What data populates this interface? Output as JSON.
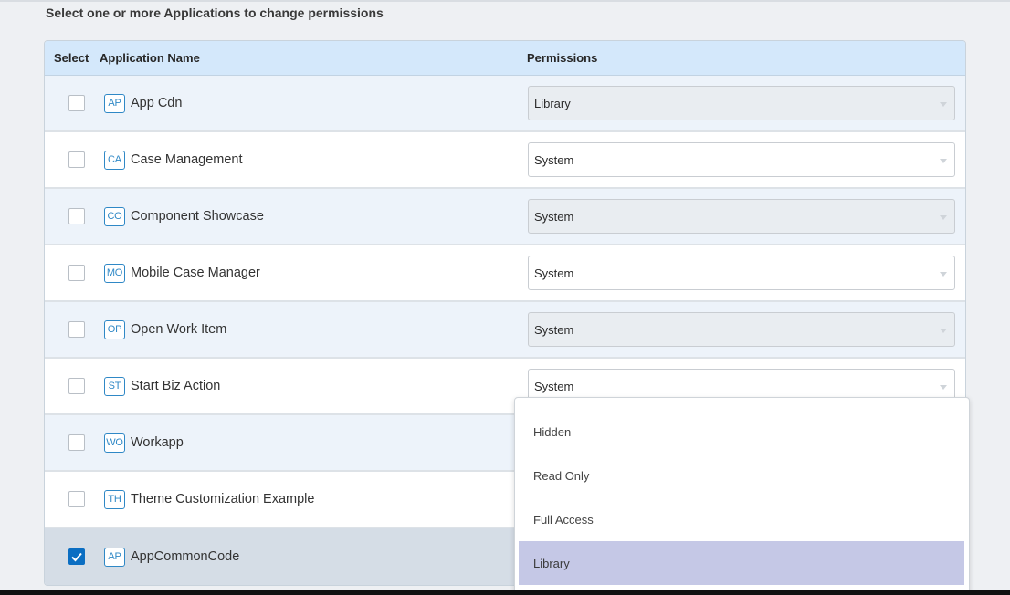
{
  "instruction": "Select one or more Applications to change permissions",
  "table": {
    "headers": {
      "select": "Select",
      "name": "Application Name",
      "permissions": "Permissions"
    },
    "rows": [
      {
        "icon": "AP",
        "name": "App Cdn",
        "permission": "Library",
        "checked": false
      },
      {
        "icon": "CA",
        "name": "Case Management",
        "permission": "System",
        "checked": false
      },
      {
        "icon": "CO",
        "name": "Component Showcase",
        "permission": "System",
        "checked": false
      },
      {
        "icon": "MO",
        "name": "Mobile Case Manager",
        "permission": "System",
        "checked": false
      },
      {
        "icon": "OP",
        "name": "Open Work Item",
        "permission": "System",
        "checked": false
      },
      {
        "icon": "ST",
        "name": "Start Biz Action",
        "permission": "System",
        "checked": false
      },
      {
        "icon": "WO",
        "name": "Workapp",
        "permission": "",
        "checked": false
      },
      {
        "icon": "TH",
        "name": "Theme Customization Example",
        "permission": "",
        "checked": false
      },
      {
        "icon": "AP",
        "name": "AppCommonCode",
        "permission": "",
        "checked": true
      }
    ]
  },
  "dropdown": {
    "options": [
      "Hidden",
      "Read Only",
      "Full Access",
      "Library"
    ],
    "highlighted": "Library"
  },
  "colors": {
    "header_bg": "#d4e8fb",
    "accent": "#0b6ec2",
    "icon_blue": "#2f88c6",
    "highlight": "#c5c8e6"
  }
}
